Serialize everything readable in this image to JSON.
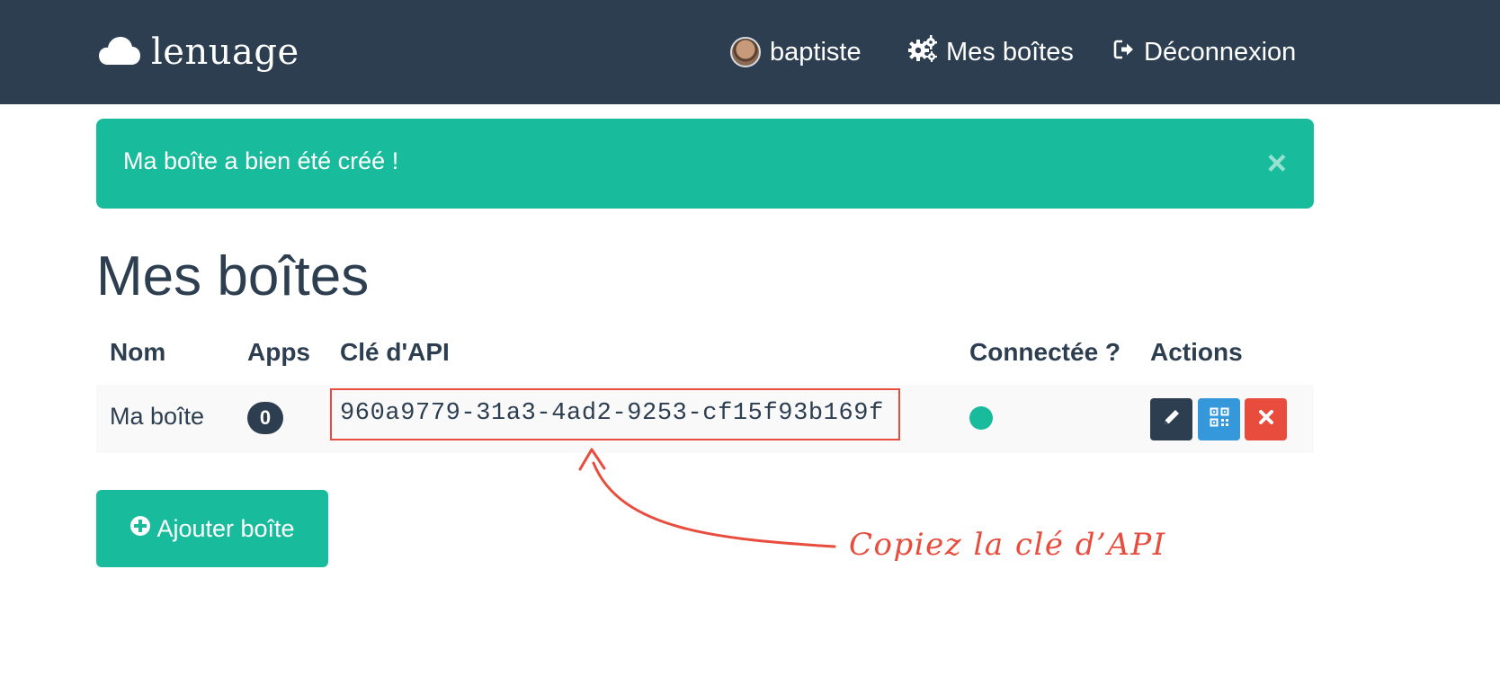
{
  "navbar": {
    "brand": "lenuage",
    "user_label": "baptiste",
    "boxes_label": "Mes boîtes",
    "logout_label": "Déconnexion",
    "background": "#2c3e50"
  },
  "alert": {
    "message": "Ma boîte a bien été créé !",
    "close_symbol": "×",
    "color": "#18bc9c"
  },
  "page": {
    "title": "Mes boîtes"
  },
  "table": {
    "headers": [
      "Nom",
      "Apps",
      "Clé d'API",
      "Connectée ?",
      "Actions"
    ],
    "rows": [
      {
        "name": "Ma boîte",
        "apps": "0",
        "api_key": "960a9779-31a3-4ad2-9253-cf15f93b169f",
        "connected": true,
        "actions": [
          "edit-icon",
          "qrcode-icon",
          "delete-icon"
        ]
      }
    ]
  },
  "add_button": {
    "label": "Ajouter boîte"
  },
  "annotation": {
    "text": "Copiez la clé d’API",
    "color": "#e74c3c"
  },
  "colors": {
    "primary": "#2c3e50",
    "success": "#18bc9c",
    "info": "#3498db",
    "danger": "#e74c3c"
  }
}
